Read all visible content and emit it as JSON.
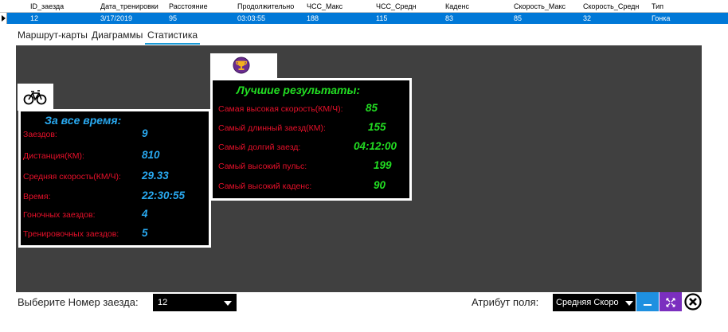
{
  "grid": {
    "columns": [
      "ID_заезда",
      "Дата_тренировки",
      "Расстояние",
      "Продолжительно",
      "ЧСС_Макс",
      "ЧСС_Средн",
      "Каденс",
      "Скорость_Макс",
      "Скорость_Средн",
      "Тип"
    ],
    "row": [
      "12",
      "3/17/2019",
      "95",
      "03:03:55",
      "188",
      "115",
      "83",
      "85",
      "32",
      "Гонка"
    ]
  },
  "tabs": [
    "Маршрут-карты",
    "Диаграммы",
    "Статистика"
  ],
  "all_time": {
    "title": "За все время:",
    "rows": [
      {
        "label": "Заездов:",
        "value": "9"
      },
      {
        "label": "Дистанция(КМ):",
        "value": "810"
      },
      {
        "label": "Средняя скорость(КМ/Ч):",
        "value": "29.33"
      },
      {
        "label": "Время:",
        "value": "22:30:55"
      },
      {
        "label": "Гоночных заездов:",
        "value": "4"
      },
      {
        "label": "Тренировочных заездов:",
        "value": "5"
      }
    ]
  },
  "best": {
    "title": "Лучшие результаты:",
    "rows": [
      {
        "label": "Самая высокая скорость(КМ/Ч):",
        "value": "85"
      },
      {
        "label": "Самый длинный заезд(КМ):",
        "value": "155"
      },
      {
        "label": "Самый долгий заезд:",
        "value": "04:12:00"
      },
      {
        "label": "Самый высокий пульс:",
        "value": "199"
      },
      {
        "label": "Самый высокий каденс:",
        "value": "90"
      }
    ]
  },
  "bottom": {
    "select_label": "Выберите Номер заезда:",
    "select_value": "12",
    "attr_label": "Атрибут поля:",
    "attr_value": "Средняя Скоро"
  },
  "icons": {
    "bike": "bicycle-icon",
    "trophy": "trophy-icon",
    "minimize": "minimize-icon",
    "restore": "restore-icon",
    "close": "close-icon"
  },
  "colors": {
    "selection": "#0078d7",
    "panel_bg": "#404040",
    "label_red": "#e8102a",
    "all_time_value": "#29a9f0",
    "best_value": "#22dd22",
    "tab_accent": "#1a9ad6",
    "minimize_btn": "#1e90e0",
    "restore_btn": "#7b2fbf"
  }
}
